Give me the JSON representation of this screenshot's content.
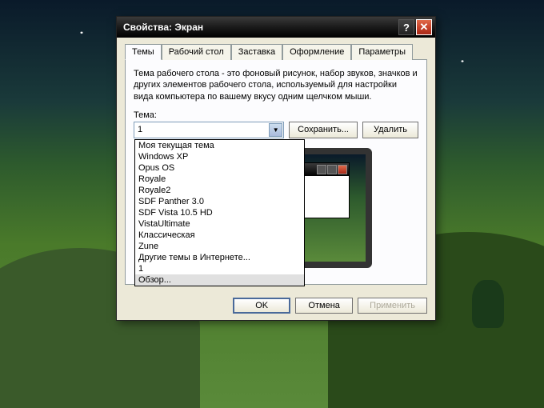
{
  "dialog": {
    "title": "Свойства: Экран",
    "tabs": [
      "Темы",
      "Рабочий стол",
      "Заставка",
      "Оформление",
      "Параметры"
    ],
    "active_tab": 0,
    "description": "Тема рабочего стола - это фоновый рисунок, набор звуков, значков и других элементов рабочего стола, используемый для настройки вида компьютера по вашему вкусу одним щелчком мыши.",
    "theme_label": "Тема:",
    "theme_value": "1",
    "theme_options": [
      "Моя текущая тема",
      "Windows XP",
      "Opus OS",
      "Royale",
      "Royale2",
      "SDF Panther 3.0",
      "SDF Vista 10.5 HD",
      "VistaUltimate",
      "Классическая",
      "Zune",
      "Другие темы в Интернете...",
      "1",
      "Обзор..."
    ],
    "highlighted_option_index": 12,
    "save_btn": "Сохранить...",
    "delete_btn": "Удалить",
    "ok_btn": "OK",
    "cancel_btn": "Отмена",
    "apply_btn": "Применить"
  }
}
